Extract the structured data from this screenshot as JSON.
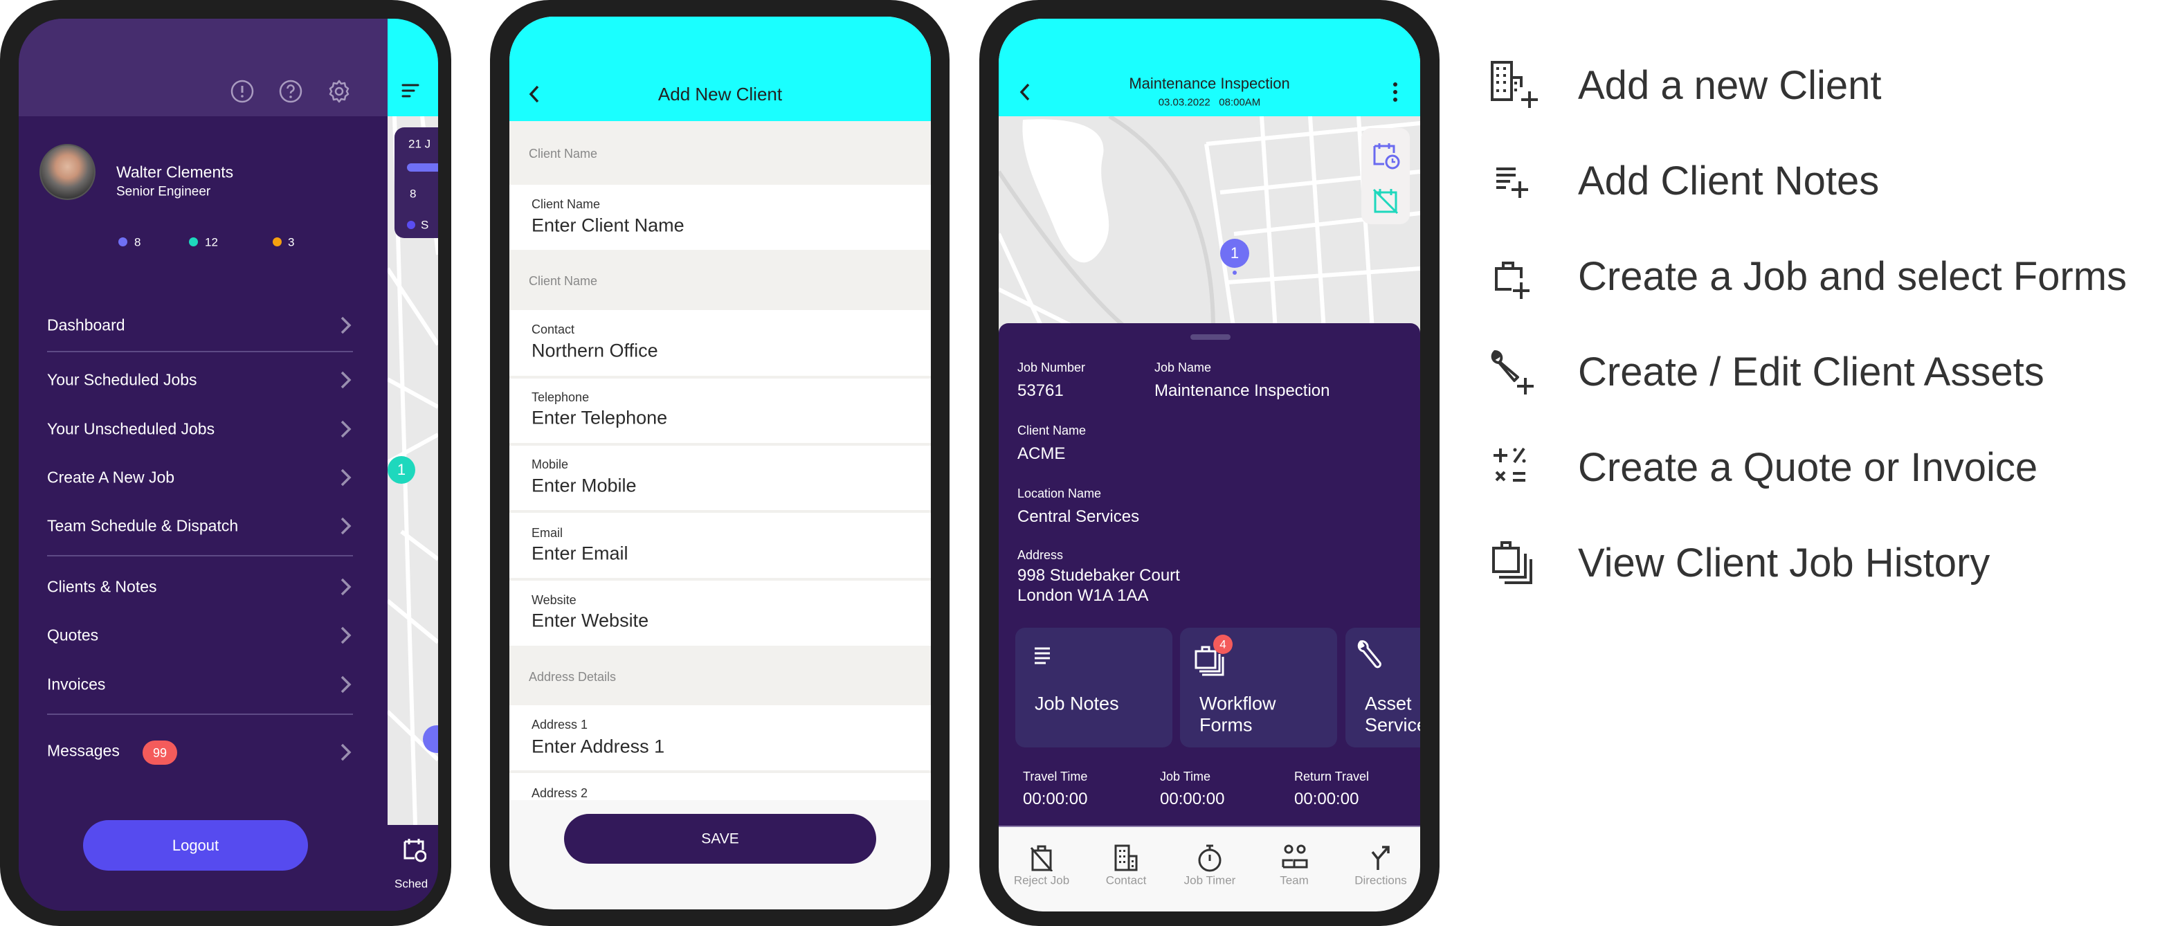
{
  "colors": {
    "brand_purple": "#33195a",
    "header_purple": "#462d6e",
    "cyan": "#1affff",
    "logout": "#564bef",
    "badge": "#f45b5b",
    "scheduled": "#7070f5",
    "in_progress": "#1ed8bd",
    "pending": "#f5a00f"
  },
  "drawer": {
    "header_icons": [
      "alert-circle-icon",
      "help-circle-icon",
      "gear-icon"
    ],
    "user": {
      "name": "Walter Clements",
      "title": "Senior Engineer"
    },
    "stats": [
      {
        "value": "8",
        "color": "#7070f5"
      },
      {
        "value": "12",
        "color": "#1ed8bd"
      },
      {
        "value": "3",
        "color": "#f5a00f"
      }
    ],
    "menu": [
      {
        "label": "Dashboard"
      },
      {
        "label": "Your Scheduled Jobs"
      },
      {
        "label": "Your Unscheduled Jobs"
      },
      {
        "label": "Create A New Job"
      },
      {
        "label": "Team Schedule & Dispatch"
      },
      {
        "label": "Clients & Notes"
      },
      {
        "label": "Quotes"
      },
      {
        "label": "Invoices"
      }
    ],
    "messages": {
      "label": "Messages",
      "badge": "99"
    },
    "logout": "Logout",
    "behind": {
      "card_date": "21 J",
      "card_count": "8",
      "card_legend": "S",
      "pin": "1",
      "nav_label": "Sched"
    }
  },
  "add_client": {
    "title": "Add New Client",
    "sections": [
      "Client Name",
      "Client Name",
      "Address Details"
    ],
    "fields": [
      {
        "label": "Client Name",
        "value": "Enter Client Name"
      },
      {
        "label": "Contact",
        "value": "Northern Office"
      },
      {
        "label": "Telephone",
        "value": "Enter Telephone"
      },
      {
        "label": "Mobile",
        "value": "Enter Mobile"
      },
      {
        "label": "Email",
        "value": "Enter Email"
      },
      {
        "label": "Website",
        "value": "Enter Website"
      },
      {
        "label": "Address 1",
        "value": "Enter Address 1"
      },
      {
        "label": "Address 2",
        "value": ""
      }
    ],
    "save": "SAVE"
  },
  "job": {
    "title": "Maintenance Inspection",
    "date": "03.03.2022   08:00AM",
    "pin": "1",
    "details": {
      "job_number_label": "Job Number",
      "job_number": "53761",
      "job_name_label": "Job Name",
      "job_name": "Maintenance Inspection",
      "client_label": "Client Name",
      "client": "ACME",
      "location_label": "Location Name",
      "location": "Central Services",
      "address_label": "Address",
      "address_line1": "998 Studebaker Court",
      "address_line2": "London W1A 1AA"
    },
    "cards": [
      {
        "line1": "Job Notes",
        "line2": "",
        "icon": "notes-icon"
      },
      {
        "line1": "Workflow",
        "line2": "Forms",
        "icon": "forms-stack-icon",
        "badge": "4"
      },
      {
        "line1": "Asset",
        "line2": "Service",
        "icon": "wrench-icon"
      }
    ],
    "timers": [
      {
        "label": "Travel Time",
        "value": "00:00:00"
      },
      {
        "label": "Job Time",
        "value": "00:00:00"
      },
      {
        "label": "Return Travel",
        "value": "00:00:00"
      }
    ],
    "nav": [
      {
        "label": "Reject Job",
        "icon": "reject-job-icon"
      },
      {
        "label": "Contact",
        "icon": "building-icon"
      },
      {
        "label": "Job Timer",
        "icon": "stopwatch-icon"
      },
      {
        "label": "Team",
        "icon": "team-icon"
      },
      {
        "label": "Directions",
        "icon": "directions-icon"
      }
    ]
  },
  "features": [
    {
      "label": "Add a new Client",
      "icon": "building-plus-icon"
    },
    {
      "label": "Add Client Notes",
      "icon": "notes-plus-icon"
    },
    {
      "label": "Create a Job and select Forms",
      "icon": "briefcase-plus-icon"
    },
    {
      "label": "Create / Edit Client Assets",
      "icon": "wrench-plus-icon"
    },
    {
      "label": "Create a Quote or Invoice",
      "icon": "calculator-icon"
    },
    {
      "label": "View Client Job History",
      "icon": "briefcase-stack-icon"
    }
  ]
}
